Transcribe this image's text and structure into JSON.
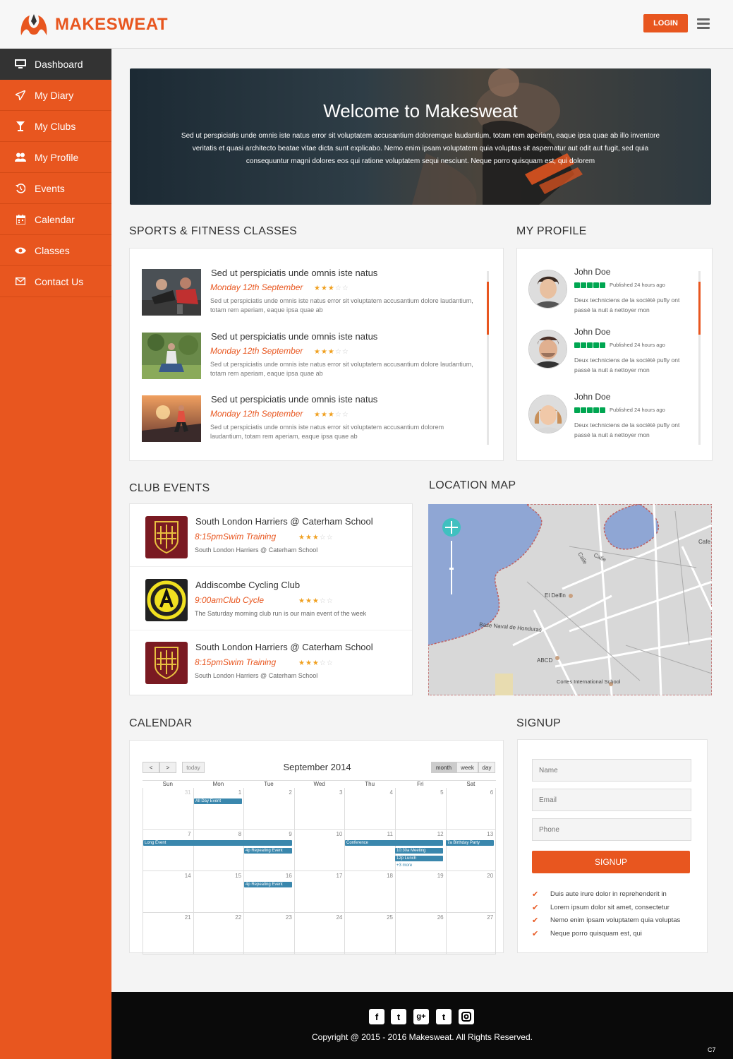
{
  "brand": {
    "name": "MAKESWEAT",
    "accent": "#e8561f"
  },
  "header": {
    "login_label": "LOGIN"
  },
  "sidebar": {
    "items": [
      {
        "label": "Dashboard",
        "icon": "monitor-icon"
      },
      {
        "label": "My Diary",
        "icon": "paper-plane-icon"
      },
      {
        "label": "My Clubs",
        "icon": "cocktail-icon"
      },
      {
        "label": "My Profile",
        "icon": "users-icon"
      },
      {
        "label": "Events",
        "icon": "history-icon"
      },
      {
        "label": "Calendar",
        "icon": "calendar-icon"
      },
      {
        "label": "Classes",
        "icon": "eye-icon"
      },
      {
        "label": "Contact Us",
        "icon": "envelope-icon"
      }
    ]
  },
  "hero": {
    "title": "Welcome to Makesweat",
    "text": "Sed ut perspiciatis unde omnis iste natus error sit voluptatem accusantium doloremque laudantium, totam rem aperiam, eaque ipsa quae ab illo inventore veritatis et quasi architecto beatae vitae dicta sunt explicabo. Nemo enim ipsam voluptatem quia voluptas sit aspernatur aut odit aut fugit, sed quia consequuntur magni dolores eos qui ratione voluptatem sequi nesciunt. Neque porro quisquam est, qui dolorem"
  },
  "classes": {
    "title": "SPORTS & FITNESS CLASSES",
    "items": [
      {
        "title": "Sed ut perspiciatis unde omnis iste natus",
        "date": "Monday 12th September",
        "rating": 3,
        "desc": "Sed ut perspiciatis unde omnis iste natus error sit voluptatem accusantium dolore laudantium, totam rem aperiam, eaque ipsa quae ab"
      },
      {
        "title": "Sed ut perspiciatis unde omnis iste natus",
        "date": "Monday 12th September",
        "rating": 3,
        "desc": "Sed ut perspiciatis unde omnis iste natus error sit voluptatem accusantium dolore laudantium, totam rem aperiam, eaque ipsa quae ab"
      },
      {
        "title": "Sed ut perspiciatis unde omnis iste natus",
        "date": "Monday 12th September",
        "rating": 3,
        "desc": "Sed ut perspiciatis unde omnis iste natus error sit voluptatem accusantium dolorem laudantium, totam rem aperiam, eaque ipsa quae ab"
      }
    ]
  },
  "profile": {
    "title": "MY PROFILE",
    "items": [
      {
        "name": "John Doe",
        "published": "Published 24 hours ago",
        "desc": "Deux techniciens de la société pufly ont passé la nuit à nettoyer mon"
      },
      {
        "name": "John Doe",
        "published": "Published 24 hours ago",
        "desc": "Deux techniciens de la société pufly ont passé la nuit à nettoyer mon"
      },
      {
        "name": "John Doe",
        "published": "Published 24 hours ago",
        "desc": "Deux techniciens de la société pufly ont passé la nuit à nettoyer mon"
      }
    ]
  },
  "events": {
    "title": "CLUB EVENTS",
    "items": [
      {
        "title": "South London Harriers @ Caterham School",
        "time": "8:15pmSwim Training",
        "rating": 3,
        "desc": "South London Harriers @ Caterham School",
        "logo": "slh-crest-icon"
      },
      {
        "title": "Addiscombe Cycling Club",
        "time": "9:00amClub Cycle",
        "rating": 3,
        "desc": "The Saturday morning club run is our main event of the week",
        "logo": "addiscombe-badge-icon"
      },
      {
        "title": "South London Harriers @ Caterham School",
        "time": "8:15pmSwim Training",
        "rating": 3,
        "desc": "South London Harriers @ Caterham School",
        "logo": "slh-crest-icon"
      }
    ]
  },
  "map": {
    "title": "LOCATION MAP",
    "labels": [
      "Calle",
      "Calle",
      "El Delfin",
      "Base Naval de Honduras",
      "ABCD",
      "Cortes International School",
      "Cafe &"
    ]
  },
  "calendar": {
    "title": "CALENDAR",
    "month": "September 2014",
    "today": "today",
    "views": [
      "month",
      "week",
      "day"
    ],
    "weekdays": [
      "Sun",
      "Mon",
      "Tue",
      "Wed",
      "Thu",
      "Fri",
      "Sat"
    ],
    "weeks": [
      [
        "31",
        "1",
        "2",
        "3",
        "4",
        "5",
        "6"
      ],
      [
        "7",
        "8",
        "9",
        "10",
        "11",
        "12",
        "13"
      ],
      [
        "14",
        "15",
        "16",
        "17",
        "18",
        "19",
        "20"
      ],
      [
        "21",
        "22",
        "23",
        "24",
        "25",
        "26",
        "27"
      ]
    ],
    "events": {
      "all_day": "All Day Event",
      "long": "Long Event",
      "repeat1": "4p Repeating Event",
      "conference": "Conference",
      "meeting": "10:30a Meeting",
      "lunch": "12p Lunch",
      "more": "+3 more",
      "birthday": "7a Birthday Party",
      "repeat2": "4p Repeating Event"
    }
  },
  "signup": {
    "title": "SIGNUP",
    "name_placeholder": "Name",
    "email_placeholder": "Email",
    "phone_placeholder": "Phone",
    "button": "SIGNUP",
    "checks": [
      "Duis aute irure dolor in reprehenderit in",
      "Lorem ipsum dolor sit amet, consectetur",
      "Nemo enim ipsam voluptatem quia voluptas",
      "Neque porro quisquam est, qui"
    ]
  },
  "footer": {
    "copyright": "Copyright @ 2015 - 2016 Makesweat. All Rights Reserved.",
    "corner": "C7",
    "social": [
      "facebook-icon",
      "twitter-icon",
      "google-plus-icon",
      "tumblr-icon",
      "instagram-icon"
    ]
  }
}
